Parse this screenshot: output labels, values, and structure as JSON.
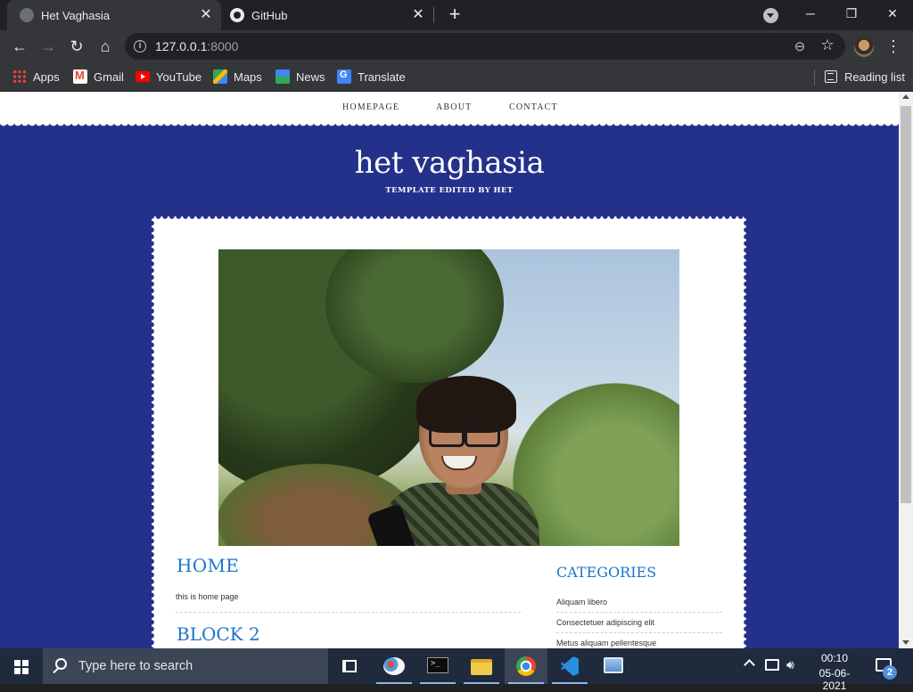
{
  "browser": {
    "tabs": [
      {
        "title": "Het Vaghasia",
        "active": true,
        "favicon": "globe-icon"
      },
      {
        "title": "GitHub",
        "active": false,
        "favicon": "github-icon"
      }
    ],
    "url_host": "127.0.0.1",
    "url_port": ":8000",
    "window_controls": {
      "minimize": "─",
      "restore": "❐",
      "close": "✕"
    },
    "bookmarks": [
      {
        "label": "Apps",
        "icon": "apps-grid-icon"
      },
      {
        "label": "Gmail",
        "icon": "gmail-icon"
      },
      {
        "label": "YouTube",
        "icon": "youtube-icon"
      },
      {
        "label": "Maps",
        "icon": "maps-icon"
      },
      {
        "label": "News",
        "icon": "news-icon"
      },
      {
        "label": "Translate",
        "icon": "translate-icon"
      }
    ],
    "reading_list": "Reading list"
  },
  "site": {
    "nav": [
      "HOMEPAGE",
      "ABOUT",
      "CONTACT"
    ],
    "title": "het vaghasia",
    "subtitle": "TEMPLATE EDITED BY HET",
    "sections": [
      {
        "heading": "HOME",
        "text": "this is home page"
      },
      {
        "heading": "BLOCK 2",
        "text": ""
      }
    ],
    "sidebar": {
      "heading": "CATEGORIES",
      "items": [
        "Aliquam libero",
        "Consectetuer adipiscing elit",
        "Metus aliquam pellentesque"
      ]
    },
    "colors": {
      "background": "#24318a",
      "heading": "#1a75c9",
      "card": "#ffffff"
    }
  },
  "taskbar": {
    "search_placeholder": "Type here to search",
    "apps": [
      "task-view-icon",
      "paint-icon",
      "terminal-icon",
      "file-explorer-icon",
      "chrome-icon",
      "vscode-icon",
      "monitor-app-icon"
    ],
    "time": "00:10",
    "date": "05-06-2021",
    "notification_count": "2"
  }
}
